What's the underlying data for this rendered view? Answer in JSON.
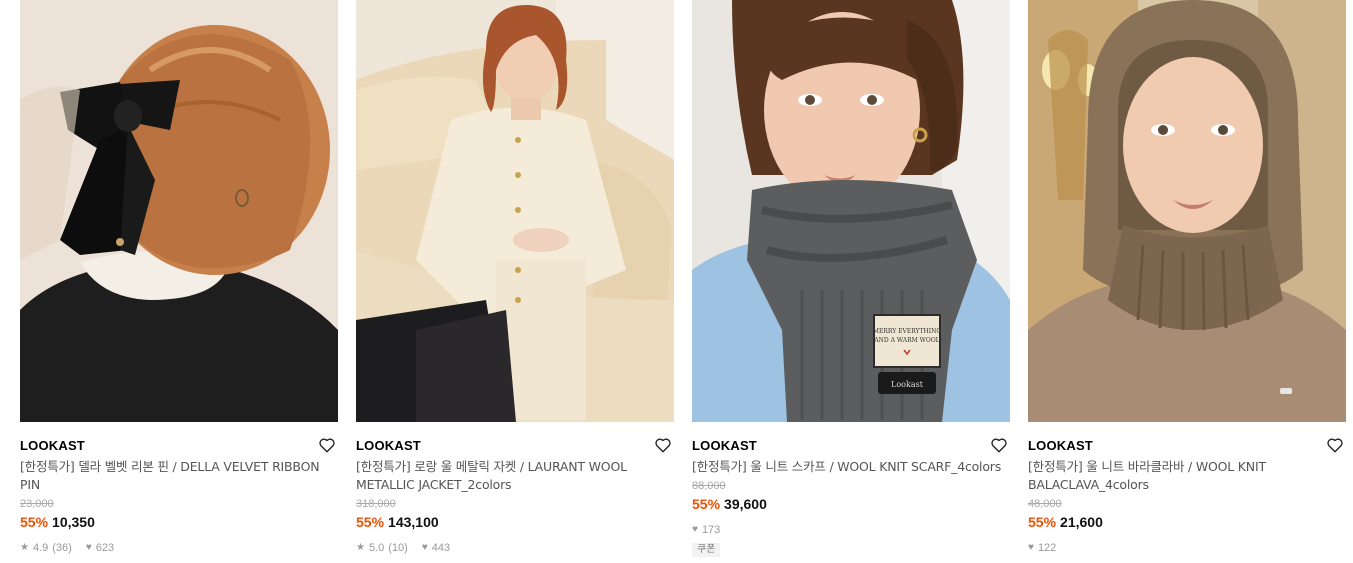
{
  "products": [
    {
      "brand": "LOOKAST",
      "name": "[한정특가] 델라 벨벳 리본 핀 / DELLA VELVET RIBBON PIN",
      "original_price": "23,000",
      "discount": "55%",
      "price": "10,350",
      "rating": "4.9",
      "reviews": "(36)",
      "likes": "623",
      "photo": "woman-with-black-velvet-ribbon"
    },
    {
      "brand": "LOOKAST",
      "name": "[한정특가] 로랑 울 메탈릭 자켓 / LAURANT WOOL METALLIC JACKET_2colors",
      "original_price": "318,000",
      "discount": "55%",
      "price": "143,100",
      "rating": "5.0",
      "reviews": "(10)",
      "likes": "443",
      "photo": "woman-in-cream-tweed-jacket"
    },
    {
      "brand": "LOOKAST",
      "name": "[한정특가] 울 니트 스카프 / WOOL KNIT SCARF_4colors",
      "original_price": "88,000",
      "discount": "55%",
      "price": "39,600",
      "likes": "173",
      "coupon": "쿠폰",
      "photo": "woman-in-grey-knit-scarf"
    },
    {
      "brand": "LOOKAST",
      "name": "[한정특가] 울 니트 바라클라바 / WOOL KNIT BALACLAVA_4colors",
      "original_price": "48,000",
      "discount": "55%",
      "price": "21,600",
      "likes": "122",
      "photo": "woman-in-brown-knit-balaclava"
    }
  ],
  "scarf_tag": {
    "line1": "MERRY EVERYTHING",
    "line2": "AND A WARM WOOL",
    "logo": "Lookast"
  },
  "colors": {
    "discount": "#f04f00",
    "text_muted": "#999999"
  },
  "icons": {
    "like": "heart-outline-icon",
    "rating": "star-icon",
    "likes": "heart-filled-icon"
  }
}
